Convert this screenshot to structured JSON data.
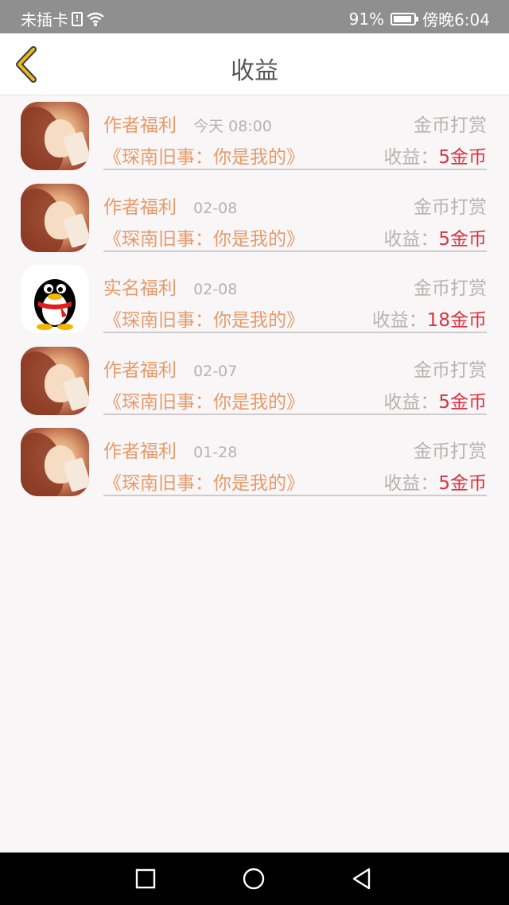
{
  "status_bar": {
    "carrier": "未插卡",
    "battery_percent": "91%",
    "time": "傍晚6:04"
  },
  "header": {
    "title": "收益"
  },
  "items": [
    {
      "avatar": "anime-girl",
      "type": "作者福利",
      "date": "今天 08:00",
      "reward_type": "金币打赏",
      "book": "《琛南旧事：你是我的》",
      "earn_label": "收益：",
      "earn_value": "5金币"
    },
    {
      "avatar": "anime-girl",
      "type": "作者福利",
      "date": "02-08",
      "reward_type": "金币打赏",
      "book": "《琛南旧事：你是我的》",
      "earn_label": "收益：",
      "earn_value": "5金币"
    },
    {
      "avatar": "qq-penguin",
      "type": "实名福利",
      "date": "02-08",
      "reward_type": "金币打赏",
      "book": "《琛南旧事：你是我的》",
      "earn_label": "收益：",
      "earn_value": "18金币"
    },
    {
      "avatar": "anime-girl",
      "type": "作者福利",
      "date": "02-07",
      "reward_type": "金币打赏",
      "book": "《琛南旧事：你是我的》",
      "earn_label": "收益：",
      "earn_value": "5金币"
    },
    {
      "avatar": "anime-girl",
      "type": "作者福利",
      "date": "01-28",
      "reward_type": "金币打赏",
      "book": "《琛南旧事：你是我的》",
      "earn_label": "收益：",
      "earn_value": "5金币"
    }
  ],
  "colors": {
    "accent": "#e89a6a",
    "earn_value": "#d8323f",
    "muted": "#b8b2b2",
    "back_icon": "#e8b923"
  }
}
